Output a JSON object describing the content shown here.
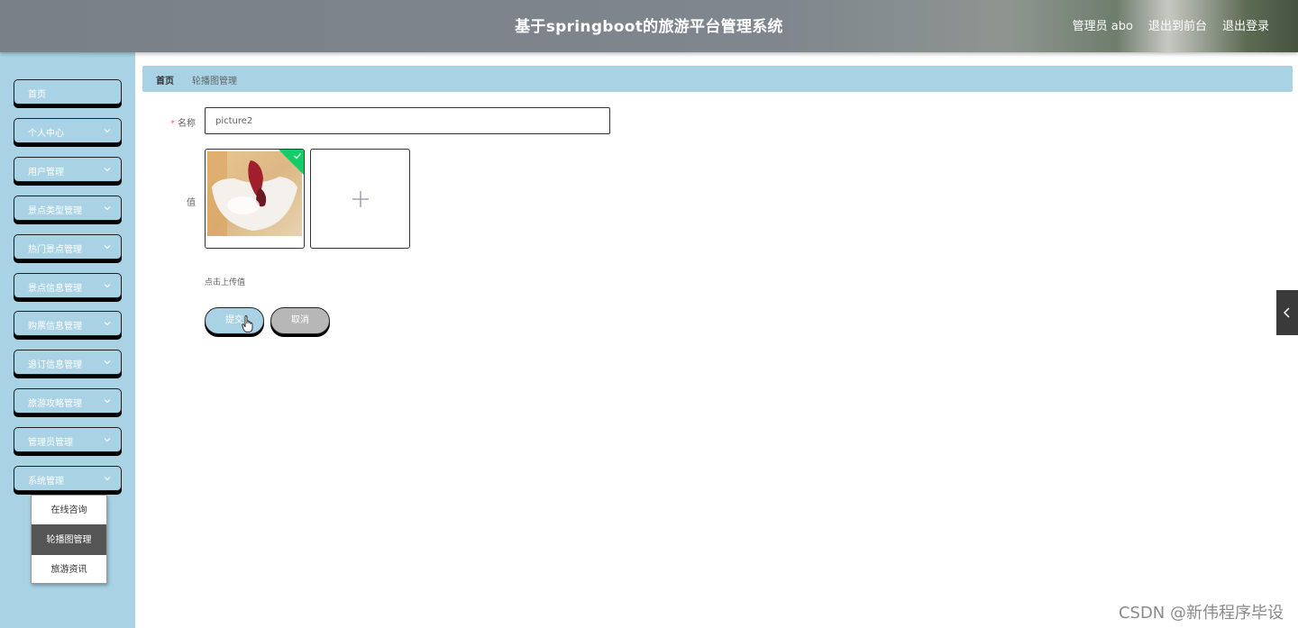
{
  "header": {
    "title": "基于springboot的旅游平台管理系统",
    "user": "管理员 abo",
    "to_front": "退出到前台",
    "logout": "退出登录"
  },
  "sidebar": {
    "items": [
      {
        "label": "首页",
        "chevron": false
      },
      {
        "label": "个人中心",
        "chevron": true
      },
      {
        "label": "用户管理",
        "chevron": true
      },
      {
        "label": "景点类型管理",
        "chevron": true
      },
      {
        "label": "热门景点管理",
        "chevron": true
      },
      {
        "label": "景点信息管理",
        "chevron": true
      },
      {
        "label": "购票信息管理",
        "chevron": true
      },
      {
        "label": "退订信息管理",
        "chevron": true
      },
      {
        "label": "旅游攻略管理",
        "chevron": true
      },
      {
        "label": "管理员管理",
        "chevron": true
      },
      {
        "label": "系统管理",
        "chevron": true
      }
    ],
    "submenu": [
      {
        "label": "在线咨询",
        "active": false
      },
      {
        "label": "轮播图管理",
        "active": true
      },
      {
        "label": "旅游资讯",
        "active": false
      }
    ]
  },
  "breadcrumb": {
    "home": "首页",
    "separator": "/",
    "current": "轮播图管理"
  },
  "form": {
    "name_label": "名称",
    "required_mark": "*",
    "name_value": "picture2",
    "value_label": "值",
    "upload_tip": "点击上传值",
    "submit": "提交",
    "cancel": "取消"
  },
  "watermark": "CSDN @新伟程序毕设",
  "colors": {
    "sidebar_bg": "#a9d3e4",
    "success": "#13ce66",
    "active_sub": "#555555"
  },
  "icons": [
    "chevron-down-icon",
    "check-icon",
    "plus-icon",
    "chevron-left-icon",
    "hand-cursor-icon"
  ]
}
